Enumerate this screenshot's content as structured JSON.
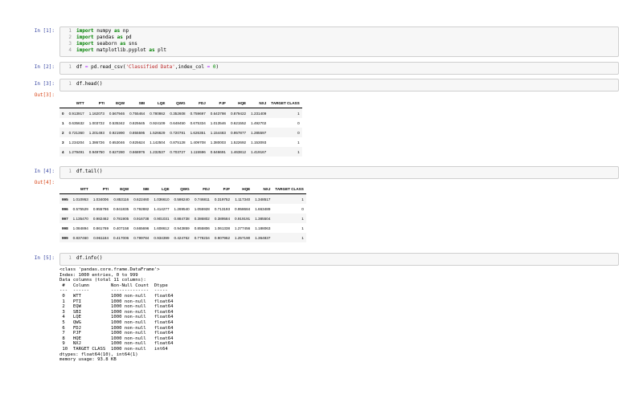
{
  "cells": [
    {
      "prompt": "In [1]:",
      "lines": [
        {
          "n": "1",
          "parts": [
            {
              "t": "import",
              "c": "kw"
            },
            {
              "t": " numpy ",
              "c": ""
            },
            {
              "t": "as",
              "c": "kw"
            },
            {
              "t": " np",
              "c": ""
            }
          ]
        },
        {
          "n": "2",
          "parts": [
            {
              "t": "import",
              "c": "kw"
            },
            {
              "t": " pandas ",
              "c": ""
            },
            {
              "t": "as",
              "c": "kw"
            },
            {
              "t": " pd",
              "c": ""
            }
          ]
        },
        {
          "n": "3",
          "parts": [
            {
              "t": "import",
              "c": "kw"
            },
            {
              "t": " seaborn ",
              "c": ""
            },
            {
              "t": "as",
              "c": "kw"
            },
            {
              "t": " sns",
              "c": ""
            }
          ]
        },
        {
          "n": "4",
          "parts": [
            {
              "t": "import",
              "c": "kw"
            },
            {
              "t": " matplotlib.pyplot ",
              "c": ""
            },
            {
              "t": "as",
              "c": "kw"
            },
            {
              "t": " plt",
              "c": ""
            }
          ]
        }
      ]
    },
    {
      "prompt": "In [2]:",
      "lines": [
        {
          "n": "1",
          "parts": [
            {
              "t": "df ",
              "c": ""
            },
            {
              "t": "=",
              "c": "op"
            },
            {
              "t": " pd.read_csv(",
              "c": ""
            },
            {
              "t": "'Classified Data'",
              "c": "str"
            },
            {
              "t": ",index_col ",
              "c": ""
            },
            {
              "t": "=",
              "c": "op"
            },
            {
              "t": " ",
              "c": ""
            },
            {
              "t": "0",
              "c": "num"
            },
            {
              "t": ")",
              "c": ""
            }
          ]
        }
      ]
    },
    {
      "prompt": "In [3]:",
      "lines": [
        {
          "n": "1",
          "parts": [
            {
              "t": "df.head()",
              "c": ""
            }
          ]
        }
      ]
    },
    {
      "prompt": "In [4]:",
      "lines": [
        {
          "n": "1",
          "parts": [
            {
              "t": "df.tail()",
              "c": ""
            }
          ]
        }
      ]
    },
    {
      "prompt": "In [5]:",
      "lines": [
        {
          "n": "1",
          "parts": [
            {
              "t": "df.info()",
              "c": ""
            }
          ]
        }
      ]
    }
  ],
  "out3": {
    "prompt": "Out[3]:",
    "columns": [
      "",
      "WTT",
      "PTI",
      "EQW",
      "SBI",
      "LQE",
      "QWG",
      "FDJ",
      "PJF",
      "HQE",
      "NXJ",
      "TARGET CLASS"
    ],
    "rows": [
      [
        "0",
        "0.913917",
        "1.162073",
        "0.567946",
        "0.755464",
        "0.780862",
        "0.352608",
        "0.759697",
        "0.643798",
        "0.879422",
        "1.231409",
        "1"
      ],
      [
        "1",
        "0.635632",
        "1.003722",
        "0.535342",
        "0.825645",
        "0.924109",
        "0.648450",
        "0.675334",
        "1.013546",
        "0.621552",
        "1.492702",
        "0"
      ],
      [
        "2",
        "0.721360",
        "1.201493",
        "0.921990",
        "0.855595",
        "1.526629",
        "0.720781",
        "1.626351",
        "1.154483",
        "0.957877",
        "1.285597",
        "0"
      ],
      [
        "3",
        "1.234204",
        "1.386726",
        "0.653046",
        "0.825624",
        "1.142504",
        "0.875128",
        "1.409708",
        "1.380003",
        "1.522692",
        "1.153093",
        "1"
      ],
      [
        "4",
        "1.279491",
        "0.949750",
        "0.627280",
        "0.668976",
        "1.232537",
        "0.703727",
        "1.115596",
        "0.646691",
        "1.463812",
        "1.419167",
        "1"
      ]
    ]
  },
  "out4": {
    "prompt": "Out[4]:",
    "columns": [
      "",
      "WTT",
      "PTI",
      "EQW",
      "SBI",
      "LQE",
      "QWG",
      "FDJ",
      "PJF",
      "HQE",
      "NXJ",
      "TARGET CLASS"
    ],
    "rows": [
      [
        "995",
        "1.010953",
        "1.034006",
        "0.853116",
        "0.622460",
        "1.036610",
        "0.586240",
        "0.746811",
        "0.319752",
        "1.117340",
        "1.348517",
        "1"
      ],
      [
        "996",
        "0.575529",
        "0.955786",
        "0.941835",
        "0.792882",
        "1.414277",
        "1.269540",
        "1.055928",
        "0.713193",
        "0.958684",
        "1.663489",
        "0"
      ],
      [
        "997",
        "1.135470",
        "0.982462",
        "0.781905",
        "0.916738",
        "0.901031",
        "0.884738",
        "0.386802",
        "0.389584",
        "0.919191",
        "1.385504",
        "1"
      ],
      [
        "998",
        "1.084894",
        "0.861769",
        "0.407158",
        "0.665696",
        "1.608612",
        "0.943859",
        "0.855806",
        "1.061338",
        "1.277456",
        "1.188063",
        "1"
      ],
      [
        "999",
        "0.837460",
        "0.961184",
        "0.417006",
        "0.799784",
        "0.934399",
        "0.424762",
        "0.778234",
        "0.907962",
        "1.257190",
        "1.364837",
        "1"
      ]
    ]
  },
  "info_lines": [
    "<class 'pandas.core.frame.DataFrame'>",
    "Index: 1000 entries, 0 to 999",
    "Data columns (total 11 columns):",
    " #   Column        Non-Null Count  Dtype  ",
    "---  ------        --------------  -----  ",
    " 0   WTT           1000 non-null   float64",
    " 1   PTI           1000 non-null   float64",
    " 2   EQW           1000 non-null   float64",
    " 3   SBI           1000 non-null   float64",
    " 4   LQE           1000 non-null   float64",
    " 5   QWG           1000 non-null   float64",
    " 6   FDJ           1000 non-null   float64",
    " 7   PJF           1000 non-null   float64",
    " 8   HQE           1000 non-null   float64",
    " 9   NXJ           1000 non-null   float64",
    " 10  TARGET CLASS  1000 non-null   int64  ",
    "dtypes: float64(10), int64(1)",
    "memory usage: 93.8 KB"
  ]
}
